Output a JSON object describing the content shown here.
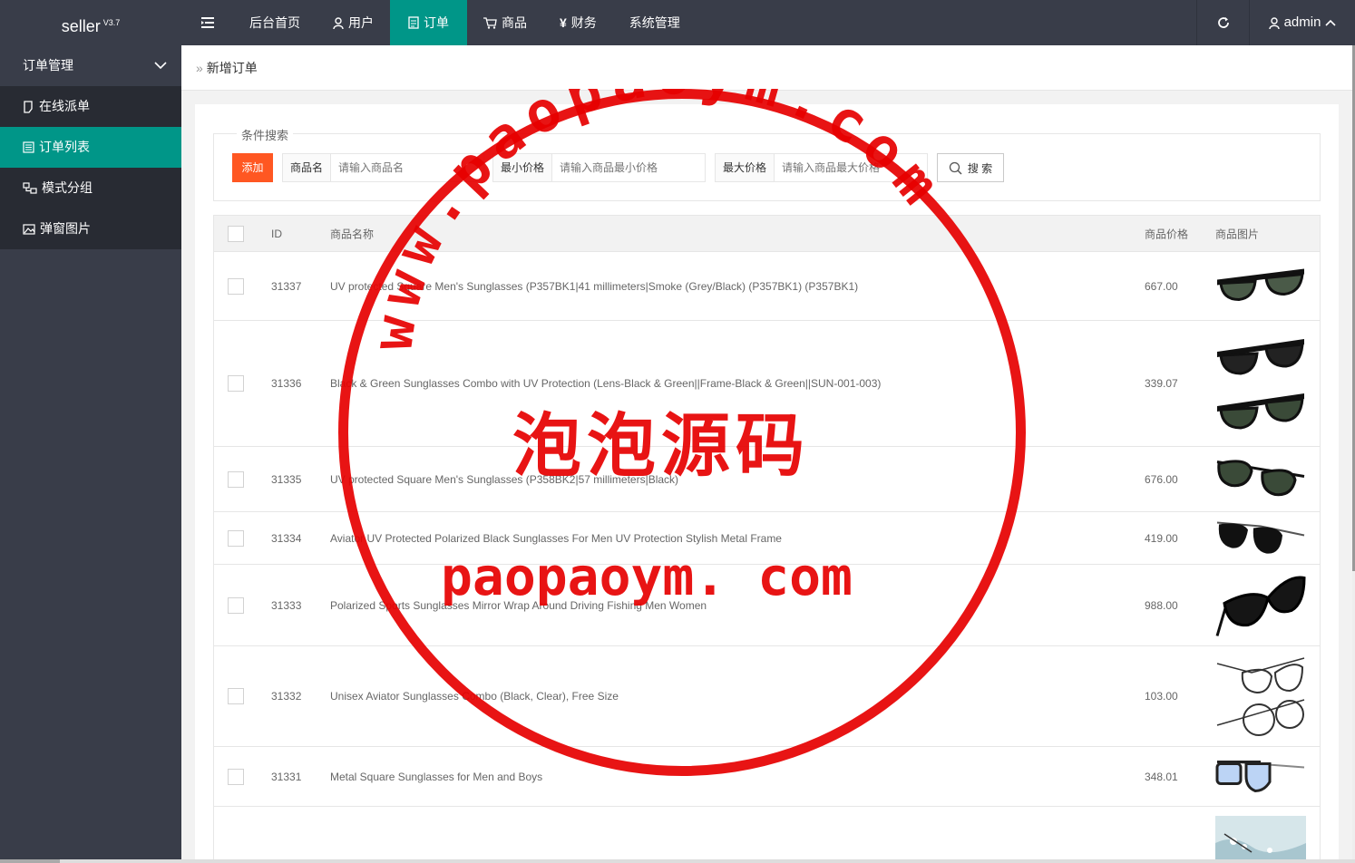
{
  "header": {
    "brand": "seller",
    "version": "V3.7",
    "nav": [
      {
        "label": "后台首页",
        "icon": ""
      },
      {
        "label": "用户",
        "icon": "user-icon"
      },
      {
        "label": "订单",
        "icon": "document-icon"
      },
      {
        "label": "商品",
        "icon": "cart-icon"
      },
      {
        "label": "财务",
        "icon": "yen-icon"
      },
      {
        "label": "系统管理",
        "icon": ""
      }
    ],
    "user": "admin"
  },
  "sidebar": {
    "group": "订单管理",
    "items": [
      {
        "label": "在线派单",
        "icon": "note-icon"
      },
      {
        "label": "订单列表",
        "icon": "list-icon"
      },
      {
        "label": "模式分组",
        "icon": "group-icon"
      },
      {
        "label": "弹窗图片",
        "icon": "image-icon"
      }
    ]
  },
  "breadcrumb": "新增订单",
  "search": {
    "legend": "条件搜索",
    "add": "添加",
    "name_label": "商品名",
    "name_placeholder": "请输入商品名",
    "min_label": "最小价格",
    "min_placeholder": "请输入商品最小价格",
    "max_label": "最大价格",
    "max_placeholder": "请输入商品最大价格",
    "button": "搜 索"
  },
  "table": {
    "headers": {
      "id": "ID",
      "name": "商品名称",
      "price": "商品价格",
      "image": "商品图片"
    },
    "rows": [
      {
        "id": "31337",
        "name": "UV protected Square Men's Sunglasses (P357BK1|41 millimeters|Smoke (Grey/Black) (P357BK1) (P357BK1)",
        "price": "667.00"
      },
      {
        "id": "31336",
        "name": "Black & Green Sunglasses Combo with UV Protection (Lens-Black & Green||Frame-Black & Green||SUN-001-003)",
        "price": "339.07"
      },
      {
        "id": "31335",
        "name": "UV protected Square Men's Sunglasses (P358BK2|57 millimeters|Black)",
        "price": "676.00"
      },
      {
        "id": "31334",
        "name": "Aviator UV Protected Polarized Black Sunglasses For Men UV Protection Stylish Metal Frame",
        "price": "419.00"
      },
      {
        "id": "31333",
        "name": "Polarized Sports Sunglasses Mirror Wrap Around Driving Fishing Men Women",
        "price": "988.00"
      },
      {
        "id": "31332",
        "name": "Unisex Aviator Sunglasses Combo (Black, Clear), Free Size",
        "price": "103.00"
      },
      {
        "id": "31331",
        "name": "Metal Square Sunglasses for Men and Boys",
        "price": "348.01"
      }
    ]
  },
  "watermark": {
    "arc": "www.paopaoym.com",
    "cn": "泡泡源码",
    "en": "paopaoym. com"
  },
  "colors": {
    "header": "#393d49",
    "accent": "#009688",
    "add": "#ff5722",
    "stamp": "#e60000"
  }
}
